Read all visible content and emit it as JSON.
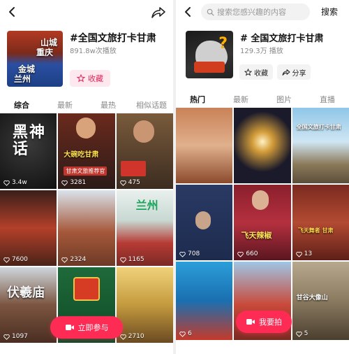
{
  "left": {
    "topic": "#全国文旅打卡甘肃",
    "plays": "891.8w次播放",
    "collect_label": "收藏",
    "thumb_text": [
      "山城",
      "重庆",
      "金城",
      "兰州"
    ],
    "tabs": [
      "综合",
      "最新",
      "最热",
      "相似话题"
    ],
    "active_tab": "综合",
    "cta_label": "立即参与",
    "cells": [
      {
        "likes": "3.4w",
        "caption": "黑神话"
      },
      {
        "likes": "3281",
        "caption": "大碗吃甘肃",
        "sub": "甘肃文旅推荐官"
      },
      {
        "likes": "475",
        "caption": ""
      },
      {
        "likes": "7600",
        "caption": ""
      },
      {
        "likes": "2324",
        "caption": ""
      },
      {
        "likes": "1165",
        "caption": "兰州"
      },
      {
        "likes": "1097",
        "caption": "伏羲庙"
      },
      {
        "likes": "",
        "caption": ""
      },
      {
        "likes": "2710",
        "caption": ""
      }
    ]
  },
  "right": {
    "search_placeholder": "搜索您感兴趣的内容",
    "search_button": "搜索",
    "topic": "# 全国文旅打卡甘肃",
    "plays": "129.3万 播放",
    "collect_label": "收藏",
    "share_label": "分享",
    "tabs": [
      "热门",
      "最新",
      "图片",
      "直播"
    ],
    "active_tab": "热门",
    "cta_label": "我要拍",
    "cells": [
      {
        "likes": "",
        "caption": ""
      },
      {
        "likes": "",
        "caption": ""
      },
      {
        "likes": "",
        "caption": "全国文旅打卡甘肃"
      },
      {
        "likes": "708",
        "caption": ""
      },
      {
        "likes": "660",
        "caption": "飞天辣椒"
      },
      {
        "likes": "13",
        "caption": "飞天舞者 甘肃"
      },
      {
        "likes": "6",
        "caption": ""
      },
      {
        "likes": "",
        "caption": ""
      },
      {
        "likes": "5",
        "caption": "甘谷大像山"
      }
    ]
  },
  "colors": {
    "accent": "#fe2c55",
    "collect_bg": "#fde8ee",
    "collect_text": "#e0245e"
  }
}
